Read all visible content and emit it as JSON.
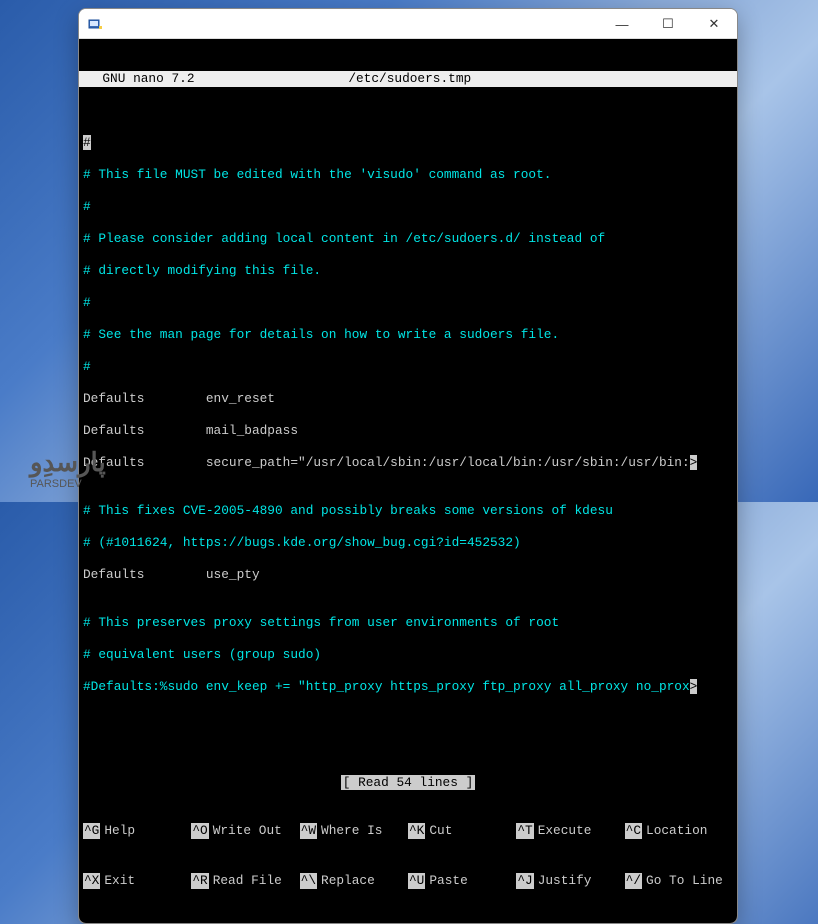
{
  "titlebar": {
    "app_icon_name": "PuTTY",
    "min_symbol": "—",
    "max_symbol": "☐",
    "close_symbol": "✕"
  },
  "editor": {
    "app": "  GNU nano 7.2",
    "file": "/etc/sudoers.tmp"
  },
  "lines": {
    "l0": "#",
    "l1": "# This file MUST be edited with the 'visudo' command as root.",
    "l2": "#",
    "l3": "# Please consider adding local content in /etc/sudoers.d/ instead of",
    "l4": "# directly modifying this file.",
    "l5": "#",
    "l6": "# See the man page for details on how to write a sudoers file.",
    "l7": "#",
    "l8": "Defaults        env_reset",
    "l9": "Defaults        mail_badpass",
    "l10a": "Defaults        secure_path=\"/usr/local/sbin:/usr/local/bin:/usr/sbin:/usr/bin:",
    "l10b": ">",
    "l11": "",
    "l12": "# This fixes CVE-2005-4890 and possibly breaks some versions of kdesu",
    "l13": "# (#1011624, https://bugs.kde.org/show_bug.cgi?id=452532)",
    "l14": "Defaults        use_pty",
    "l15": "",
    "l16": "# This preserves proxy settings from user environments of root",
    "l17": "# equivalent users (group sudo)",
    "l18a": "#Defaults:%sudo env_keep += \"http_proxy https_proxy ftp_proxy all_proxy no_prox",
    "l18b": ">",
    "l19": ""
  },
  "status": "[ Read 54 lines ]",
  "shortcuts": {
    "row1": [
      {
        "key": "^G",
        "label": "Help"
      },
      {
        "key": "^O",
        "label": "Write Out"
      },
      {
        "key": "^W",
        "label": "Where Is"
      },
      {
        "key": "^K",
        "label": "Cut"
      },
      {
        "key": "^T",
        "label": "Execute"
      },
      {
        "key": "^C",
        "label": "Location"
      }
    ],
    "row2": [
      {
        "key": "^X",
        "label": "Exit"
      },
      {
        "key": "^R",
        "label": "Read File"
      },
      {
        "key": "^\\",
        "label": "Replace"
      },
      {
        "key": "^U",
        "label": "Paste"
      },
      {
        "key": "^J",
        "label": "Justify"
      },
      {
        "key": "^/",
        "label": "Go To Line"
      }
    ]
  },
  "brand": {
    "persian": "پارسدِو",
    "latin": "PARSDEV"
  }
}
